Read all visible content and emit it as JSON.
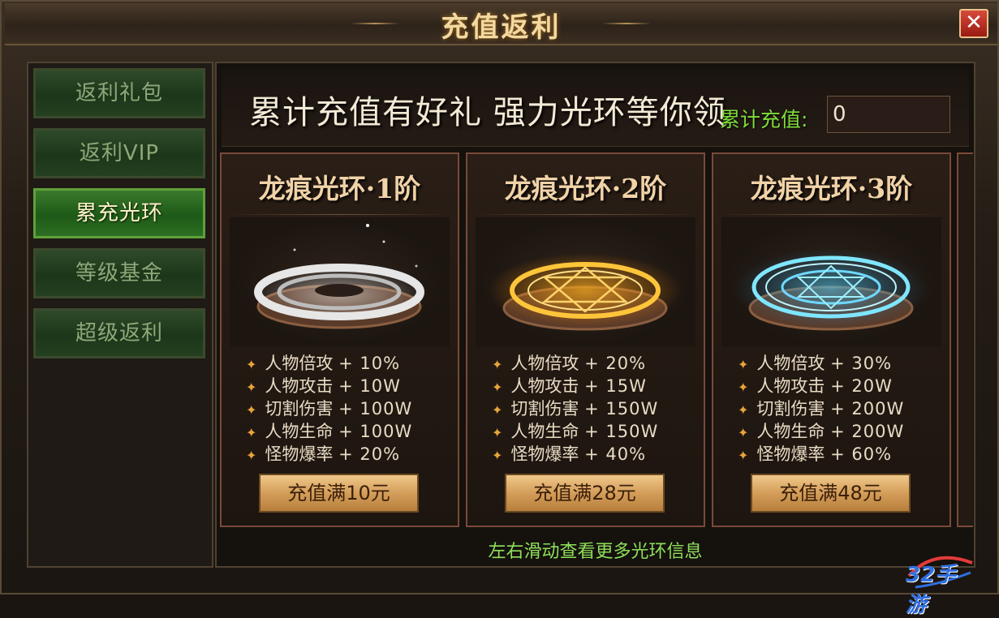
{
  "window": {
    "title": "充值返利",
    "close_label": "✕"
  },
  "sidebar": {
    "items": [
      {
        "label": "返利礼包",
        "active": false
      },
      {
        "label": "返利VIP",
        "active": false
      },
      {
        "label": "累充光环",
        "active": true
      },
      {
        "label": "等级基金",
        "active": false
      },
      {
        "label": "超级返利",
        "active": false
      }
    ]
  },
  "banner": {
    "text": "累计充值有好礼 强力光环等你领",
    "cumulative_label": "累计充值:",
    "cumulative_value": "0"
  },
  "cards": [
    {
      "title": "龙痕光环·1阶",
      "ring_color": "#d8d8d8",
      "stats": [
        {
          "name": "人物倍攻",
          "value": "+ 10%"
        },
        {
          "name": "人物攻击",
          "value": "+ 10W"
        },
        {
          "name": "切割伤害",
          "value": "+ 100W"
        },
        {
          "name": "人物生命",
          "value": "+ 100W"
        },
        {
          "name": "怪物爆率",
          "value": "+ 20%"
        }
      ],
      "button": "充值满10元"
    },
    {
      "title": "龙痕光环·2阶",
      "ring_color": "#ffb21e",
      "stats": [
        {
          "name": "人物倍攻",
          "value": "+ 20%"
        },
        {
          "name": "人物攻击",
          "value": "+ 15W"
        },
        {
          "name": "切割伤害",
          "value": "+ 150W"
        },
        {
          "name": "人物生命",
          "value": "+ 150W"
        },
        {
          "name": "怪物爆率",
          "value": "+ 40%"
        }
      ],
      "button": "充值满28元"
    },
    {
      "title": "龙痕光环·3阶",
      "ring_color": "#4fd2ff",
      "stats": [
        {
          "name": "人物倍攻",
          "value": "+ 30%"
        },
        {
          "name": "人物攻击",
          "value": "+ 20W"
        },
        {
          "name": "切割伤害",
          "value": "+ 200W"
        },
        {
          "name": "人物生命",
          "value": "+ 200W"
        },
        {
          "name": "怪物爆率",
          "value": "+ 60%"
        }
      ],
      "button": "充值满48元"
    }
  ],
  "hint": "左右滑动查看更多光环信息",
  "watermark": "32手游"
}
